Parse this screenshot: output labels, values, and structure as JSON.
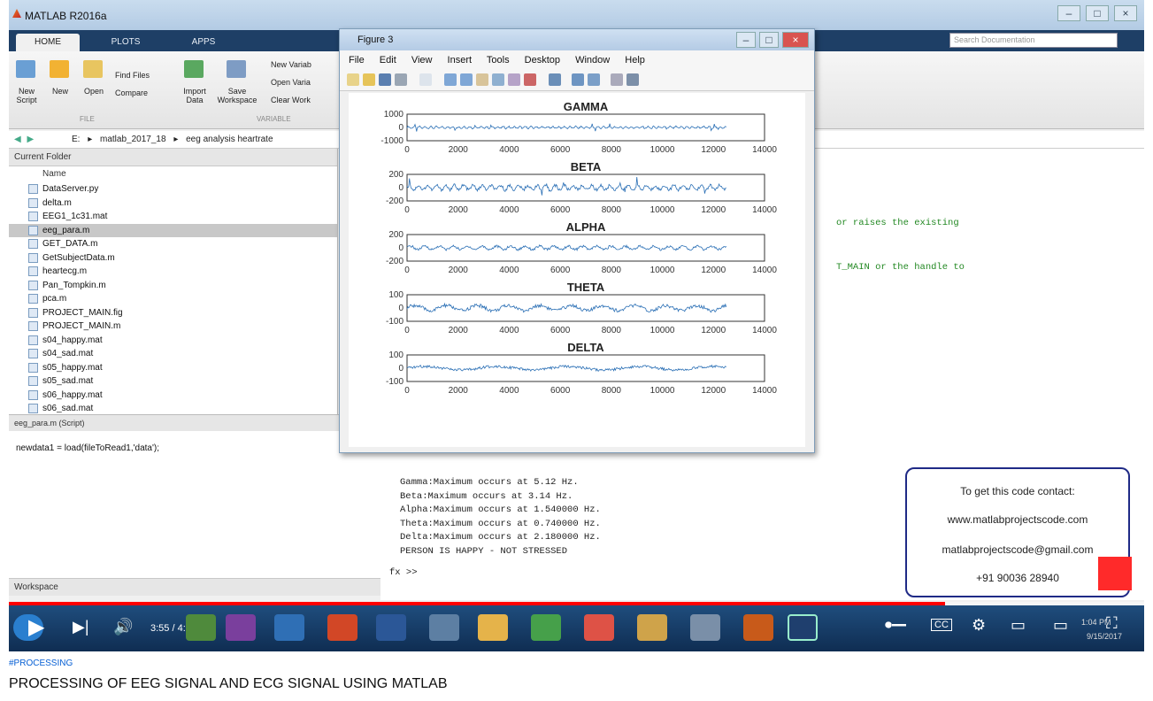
{
  "matlab": {
    "app_title": "MATLAB R2016a",
    "tabs": [
      "HOME",
      "PLOTS",
      "APPS"
    ],
    "search_placeholder": "Search Documentation",
    "ribbon": {
      "new_script": "New\nScript",
      "new": "New",
      "open": "Open",
      "find_files": "Find Files",
      "compare": "Compare",
      "import_data": "Import\nData",
      "save_workspace": "Save\nWorkspace",
      "new_variable": "New Variab",
      "open_variable": "Open Varia",
      "clear_workspace": "Clear Work",
      "section_file": "FILE",
      "section_variable": "VARIABLE"
    },
    "address": [
      "E:",
      "matlab_2017_18",
      "eeg analysis heartrate"
    ],
    "current_folder_label": "Current Folder",
    "name_column": "Name",
    "files": [
      "DataServer.py",
      "delta.m",
      "EEG1_1c31.mat",
      "eeg_para.m",
      "GET_DATA.m",
      "GetSubjectData.m",
      "heartecg.m",
      "Pan_Tompkin.m",
      "pca.m",
      "PROJECT_MAIN.fig",
      "PROJECT_MAIN.m",
      "s04_happy.mat",
      "s04_sad.mat",
      "s05_happy.mat",
      "s05_sad.mat",
      "s06_happy.mat",
      "s06_sad.mat"
    ],
    "selected_file": "eeg_para.m",
    "editor_title": "eeg_para.m (Script)",
    "editor_code": "newdata1 = load(fileToRead1,'data');",
    "workspace_label": "Workspace",
    "code_line1": "or raises the existing",
    "code_line2": "T_MAIN or the handle to",
    "command_output": [
      "Gamma:Maximum occurs at 5.12 Hz.",
      "Beta:Maximum occurs at 3.14 Hz.",
      "Alpha:Maximum occurs at 1.540000 Hz.",
      "Theta:Maximum occurs at 0.740000 Hz.",
      "Delta:Maximum occurs at 2.180000 Hz.",
      "PERSON IS HAPPY - NOT STRESSED"
    ],
    "prompt": "fx >>"
  },
  "figure": {
    "title": "Figure 3",
    "menu": [
      "File",
      "Edit",
      "View",
      "Insert",
      "Tools",
      "Desktop",
      "Window",
      "Help"
    ]
  },
  "chart_data": [
    {
      "type": "line",
      "title": "GAMMA",
      "xlim": [
        0,
        14000
      ],
      "ylim": [
        -1000,
        1000
      ],
      "yticks": [
        "1000",
        "0",
        "-1000"
      ],
      "xticks": [
        "0",
        "2000",
        "4000",
        "6000",
        "8000",
        "10000",
        "12000",
        "14000"
      ],
      "x_end": 12500,
      "peak": 250
    },
    {
      "type": "line",
      "title": "BETA",
      "xlim": [
        0,
        14000
      ],
      "ylim": [
        -200,
        200
      ],
      "yticks": [
        "200",
        "0",
        "-200"
      ],
      "xticks": [
        "0",
        "2000",
        "4000",
        "6000",
        "8000",
        "10000",
        "12000",
        "14000"
      ],
      "x_end": 12500,
      "peak": 120
    },
    {
      "type": "line",
      "title": "ALPHA",
      "xlim": [
        0,
        14000
      ],
      "ylim": [
        -200,
        200
      ],
      "yticks": [
        "200",
        "0",
        "-200"
      ],
      "xticks": [
        "0",
        "2000",
        "4000",
        "6000",
        "8000",
        "10000",
        "12000",
        "14000"
      ],
      "x_end": 12500,
      "peak": 90
    },
    {
      "type": "line",
      "title": "THETA",
      "xlim": [
        0,
        14000
      ],
      "ylim": [
        -100,
        100
      ],
      "yticks": [
        "100",
        "0",
        "-100"
      ],
      "xticks": [
        "0",
        "2000",
        "4000",
        "6000",
        "8000",
        "10000",
        "12000",
        "14000"
      ],
      "x_end": 12500,
      "peak": 70
    },
    {
      "type": "line",
      "title": "DELTA",
      "xlim": [
        0,
        14000
      ],
      "ylim": [
        -100,
        100
      ],
      "yticks": [
        "100",
        "0",
        "-100"
      ],
      "xticks": [
        "0",
        "2000",
        "4000",
        "6000",
        "8000",
        "10000",
        "12000",
        "14000"
      ],
      "x_end": 12500,
      "peak": 50
    }
  ],
  "overlay": {
    "line1": "To get this code contact:",
    "line2": "www.matlabprojectscode.com",
    "line3": "matlabprojectscode@gmail.com",
    "line4": "+91 90036 28940"
  },
  "player": {
    "time": "3:55 / 4:42",
    "progress": 0.825,
    "clock_time": "1:04 PM",
    "clock_date": "9/15/2017",
    "accent": "#ff0000"
  },
  "video": {
    "hashtag": "#PROCESSING",
    "title": "PROCESSING OF EEG SIGNAL AND ECG SIGNAL USING MATLAB"
  }
}
